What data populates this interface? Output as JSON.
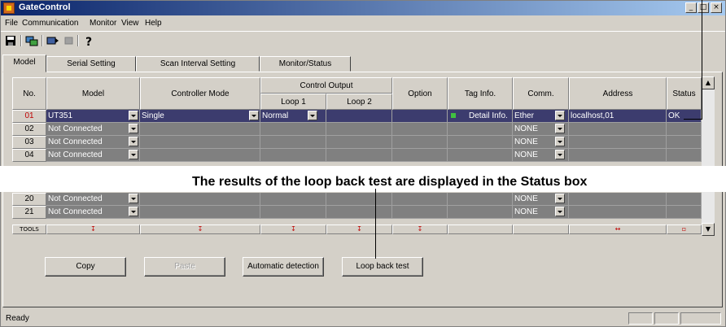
{
  "window": {
    "title": "GateControl",
    "minimize": "_",
    "maximize": "□",
    "close": "×"
  },
  "menu": [
    "File",
    "Communication",
    "Monitor",
    "View",
    "Help"
  ],
  "toolbar": {
    "icons": [
      "save-icon",
      "connect-icon",
      "export-icon",
      "stop-icon",
      "help-icon"
    ]
  },
  "tabs": [
    "Model",
    "Serial Setting",
    "Scan Interval Setting",
    "Monitor/Status"
  ],
  "active_tab": "Model",
  "grid": {
    "headers": {
      "no": "No.",
      "model": "Model",
      "controller_mode": "Controller Mode",
      "control_output": "Control Output",
      "loop1": "Loop 1",
      "loop2": "Loop 2",
      "option": "Option",
      "tag_info": "Tag Info.",
      "comm": "Comm.",
      "address": "Address",
      "status": "Status"
    },
    "rows": [
      {
        "no": "01",
        "model": "UT351",
        "mode": "Single",
        "loop1": "Normal",
        "tag": "Detail Info.",
        "comm": "Ether",
        "address": "localhost,01",
        "status": "OK"
      },
      {
        "no": "02",
        "model": "Not Connected",
        "comm": "NONE"
      },
      {
        "no": "03",
        "model": "Not Connected",
        "comm": "NONE"
      },
      {
        "no": "04",
        "model": "Not Connected",
        "comm": "NONE"
      },
      {
        "no": "20",
        "model": "Not Connected",
        "comm": "NONE"
      },
      {
        "no": "21",
        "model": "Not Connected",
        "comm": "NONE"
      }
    ],
    "tools_label": "TOOLS"
  },
  "buttons": {
    "copy": "Copy",
    "paste": "Paste",
    "auto_detect": "Automatic detection",
    "loop_back": "Loop back test"
  },
  "statusbar": {
    "text": "Ready"
  },
  "annotation": {
    "text": "The results of the loop back test are displayed in the Status box"
  },
  "colors": {
    "title_start": "#0a246a",
    "title_end": "#a6caf0",
    "row_bg": "#808080",
    "selected_row_bg": "#3c3c6e",
    "row_number_red": "#c00000"
  }
}
